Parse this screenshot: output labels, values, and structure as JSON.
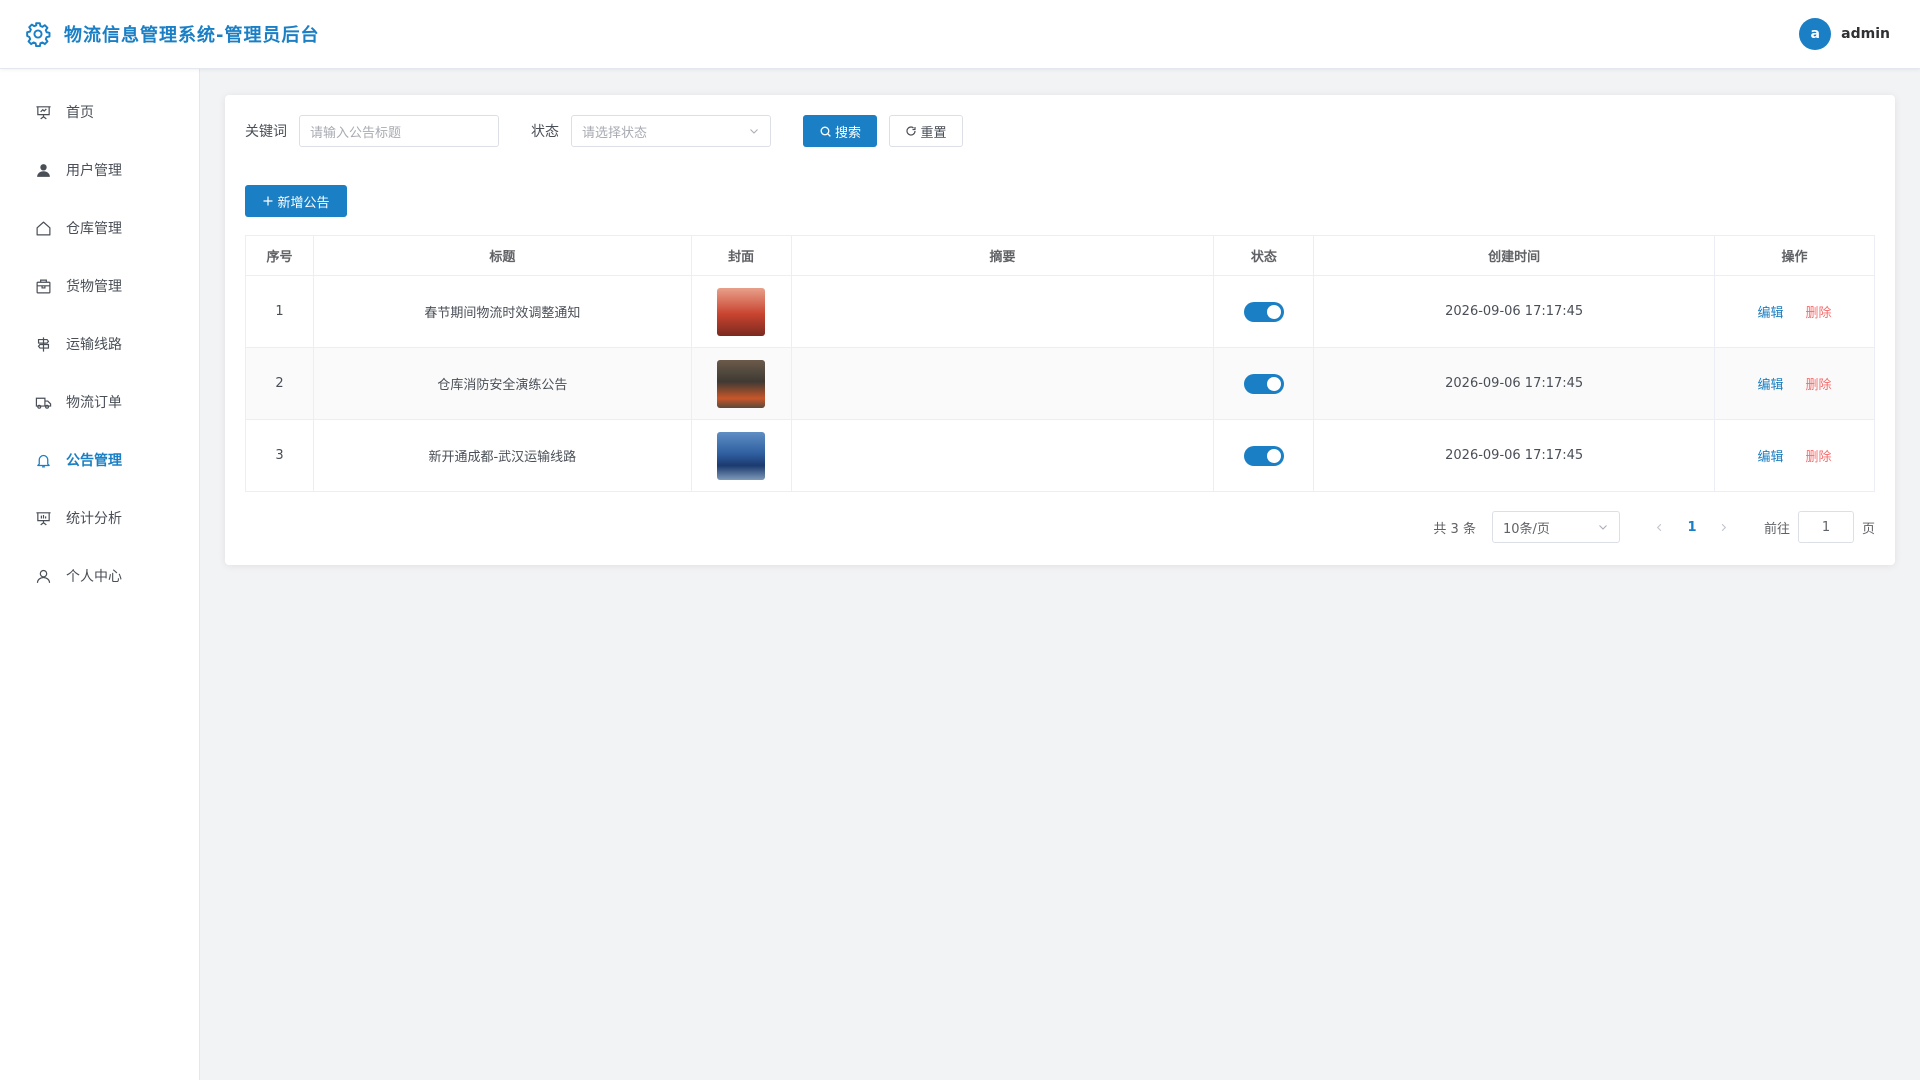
{
  "header": {
    "title": "物流信息管理系统-管理员后台",
    "user": {
      "avatar_letter": "a",
      "name": "admin"
    }
  },
  "sidebar": {
    "items": [
      {
        "label": "首页",
        "icon": "presentation-icon"
      },
      {
        "label": "用户管理",
        "icon": "user-filled-icon"
      },
      {
        "label": "仓库管理",
        "icon": "house-icon"
      },
      {
        "label": "货物管理",
        "icon": "box-icon"
      },
      {
        "label": "运输线路",
        "icon": "signpost-icon"
      },
      {
        "label": "物流订单",
        "icon": "truck-icon"
      },
      {
        "label": "公告管理",
        "icon": "bell-icon",
        "active": true
      },
      {
        "label": "统计分析",
        "icon": "chart-board-icon"
      },
      {
        "label": "个人中心",
        "icon": "user-outline-icon"
      }
    ]
  },
  "search": {
    "keyword_label": "关键词",
    "keyword_placeholder": "请输入公告标题",
    "status_label": "状态",
    "status_placeholder": "请选择状态",
    "search_button": "搜索",
    "reset_button": "重置"
  },
  "add_button": "新增公告",
  "table": {
    "columns": [
      "序号",
      "标题",
      "封面",
      "摘要",
      "状态",
      "创建时间",
      "操作"
    ],
    "rows": [
      {
        "index": "1",
        "title": "春节期间物流时效调整通知",
        "summary": "",
        "enabled": true,
        "created": "2026-09-06 17:17:45"
      },
      {
        "index": "2",
        "title": "仓库消防安全演练公告",
        "summary": "",
        "enabled": true,
        "created": "2026-09-06 17:17:45"
      },
      {
        "index": "3",
        "title": "新开通成都-武汉运输线路",
        "summary": "",
        "enabled": true,
        "created": "2026-09-06 17:17:45"
      }
    ],
    "edit_label": "编辑",
    "delete_label": "删除"
  },
  "pagination": {
    "total_text": "共 3 条",
    "page_size": "10条/页",
    "current_page": "1",
    "goto_label": "前往",
    "goto_value": "1",
    "page_suffix": "页"
  },
  "colors": {
    "accent": "#1a7fc4",
    "danger": "#f56c6c"
  }
}
